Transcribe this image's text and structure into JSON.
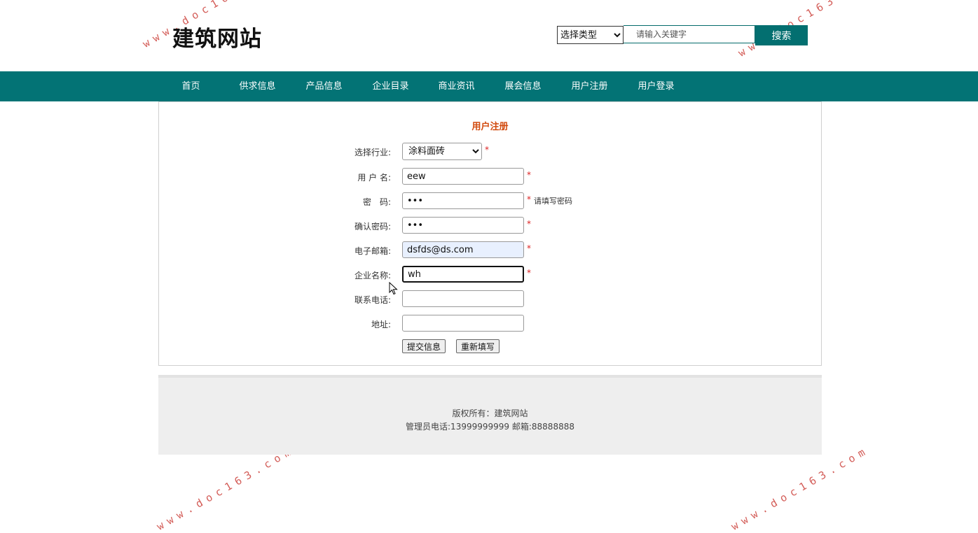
{
  "header": {
    "site_title": "建筑网站",
    "search_type_selected": "选择类型",
    "search_placeholder": "请输入关键字",
    "search_button": "搜索"
  },
  "nav": [
    "首页",
    "供求信息",
    "产品信息",
    "企业目录",
    "商业资讯",
    "展会信息",
    "用户注册",
    "用户登录"
  ],
  "form": {
    "title": "用户注册",
    "industry_label": "选择行业:",
    "industry_selected": "涂料面砖",
    "username_label": "用 户 名:",
    "username_value": "eew",
    "password_label": "密　码:",
    "password_value": "•••",
    "password_hint": "请填写密码",
    "confirm_label": "确认密码:",
    "confirm_value": "•••",
    "email_label": "电子邮箱:",
    "email_value": "dsfds@ds.com",
    "company_label": "企业名称:",
    "company_value": "wh",
    "phone_label": "联系电话:",
    "phone_value": "",
    "address_label": "地址:",
    "address_value": "",
    "required_mark": "*",
    "submit_button": "提交信息",
    "reset_button": "重新填写"
  },
  "footer": {
    "copyright": "版权所有：建筑网站",
    "contact": "管理员电话:13999999999 邮箱:88888888"
  },
  "watermark": "www.doc163.com",
  "colors": {
    "accent": "#037375",
    "form_title": "#d24a0e",
    "required": "#dd2222"
  }
}
